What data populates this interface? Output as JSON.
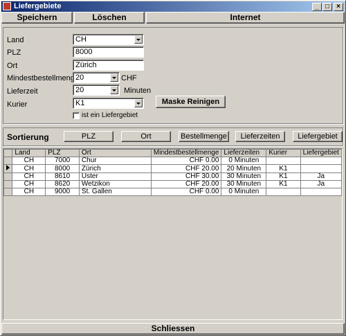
{
  "window": {
    "title": "Liefergebiete"
  },
  "toolbar": {
    "save": "Speichern",
    "delete": "Löschen",
    "internet": "Internet"
  },
  "form": {
    "land_label": "Land",
    "land_value": "CH",
    "plz_label": "PLZ",
    "plz_value": "8000",
    "ort_label": "Ort",
    "ort_value": "Zürich",
    "min_label": "Mindestbestellmenge",
    "min_value": "20",
    "min_unit": "CHF",
    "lieferzeit_label": "Lieferzeit",
    "lieferzeit_value": "20",
    "lieferzeit_unit": "Minuten",
    "kurier_label": "Kurier",
    "kurier_value": "K1",
    "checkbox_label": "ist ein Liefergebiet",
    "clear_button": "Maske Reinigen"
  },
  "sort": {
    "label": "Sortierung",
    "plz": "PLZ",
    "ort": "Ort",
    "bestellmenge": "Bestellmenge",
    "lieferzeiten": "Lieferzeiten",
    "liefergebiet": "Liefergebiet"
  },
  "table": {
    "headers": [
      "Land",
      "PLZ",
      "Ort",
      "Mindestbestellmenge",
      "Lieferzeiten",
      "Kurier",
      "Liefergebiet"
    ],
    "rows": [
      [
        "CH",
        "7000",
        "Chur",
        "CHF 0.00",
        "0 Minuten",
        "",
        ""
      ],
      [
        "CH",
        "8000",
        "Zürich",
        "CHF 20.00",
        "20 Minuten",
        "K1",
        ""
      ],
      [
        "CH",
        "8610",
        "Uster",
        "CHF 30.00",
        "30 Minuten",
        "K1",
        "Ja"
      ],
      [
        "CH",
        "8620",
        "Wetzikon",
        "CHF 20.00",
        "30 Minuten",
        "K1",
        "Ja"
      ],
      [
        "CH",
        "9000",
        "St. Gallen",
        "CHF 0.00",
        "0 Minuten",
        "",
        ""
      ]
    ]
  },
  "footer": {
    "close": "Schliessen"
  }
}
